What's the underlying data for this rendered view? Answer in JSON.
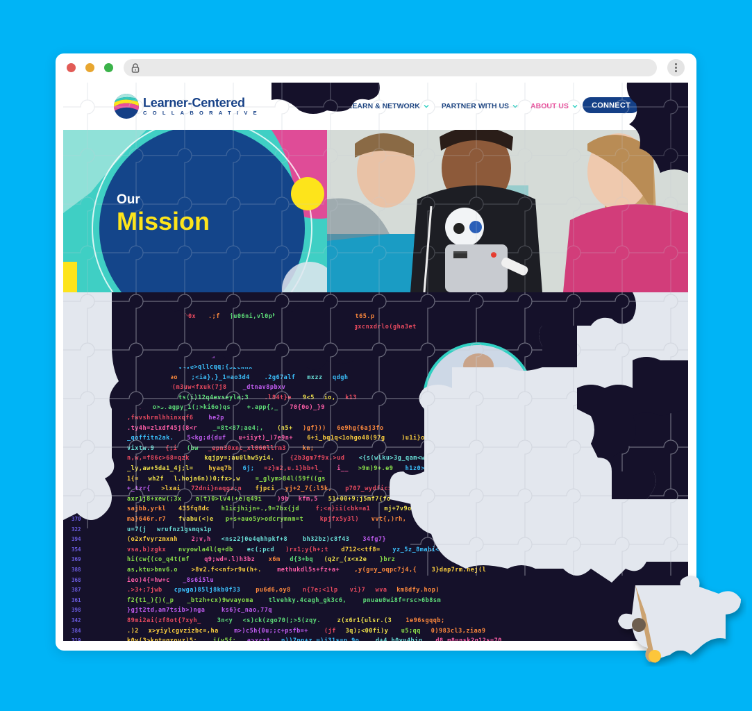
{
  "browser": {
    "traffic_lights": [
      "close",
      "minimize",
      "maximize"
    ],
    "address_bar": {
      "icon": "lock-icon",
      "url": ""
    },
    "menu_icon": "kebab-menu-icon"
  },
  "site": {
    "logo": {
      "title": "Learner-Centered",
      "subtitle": "COLLABORATIVE"
    },
    "nav": [
      {
        "label": "LEARN & NETWORK",
        "has_dropdown": true,
        "active": false
      },
      {
        "label": "PARTNER WITH US",
        "has_dropdown": true,
        "active": false
      },
      {
        "label": "ABOUT US",
        "has_dropdown": true,
        "active": true
      }
    ],
    "cta": {
      "label": "CONNECT"
    },
    "hero": {
      "eyebrow": "Our",
      "title": "Mission"
    }
  },
  "colors": {
    "page_bg": "#00b4f6",
    "brand_navy": "#143f86",
    "accent_pink": "#e94d9a",
    "accent_yellow": "#fde41b",
    "accent_teal": "#2fd0c2",
    "code_bg": "#15112a",
    "puzzle_piece": "#e3e7ee"
  }
}
